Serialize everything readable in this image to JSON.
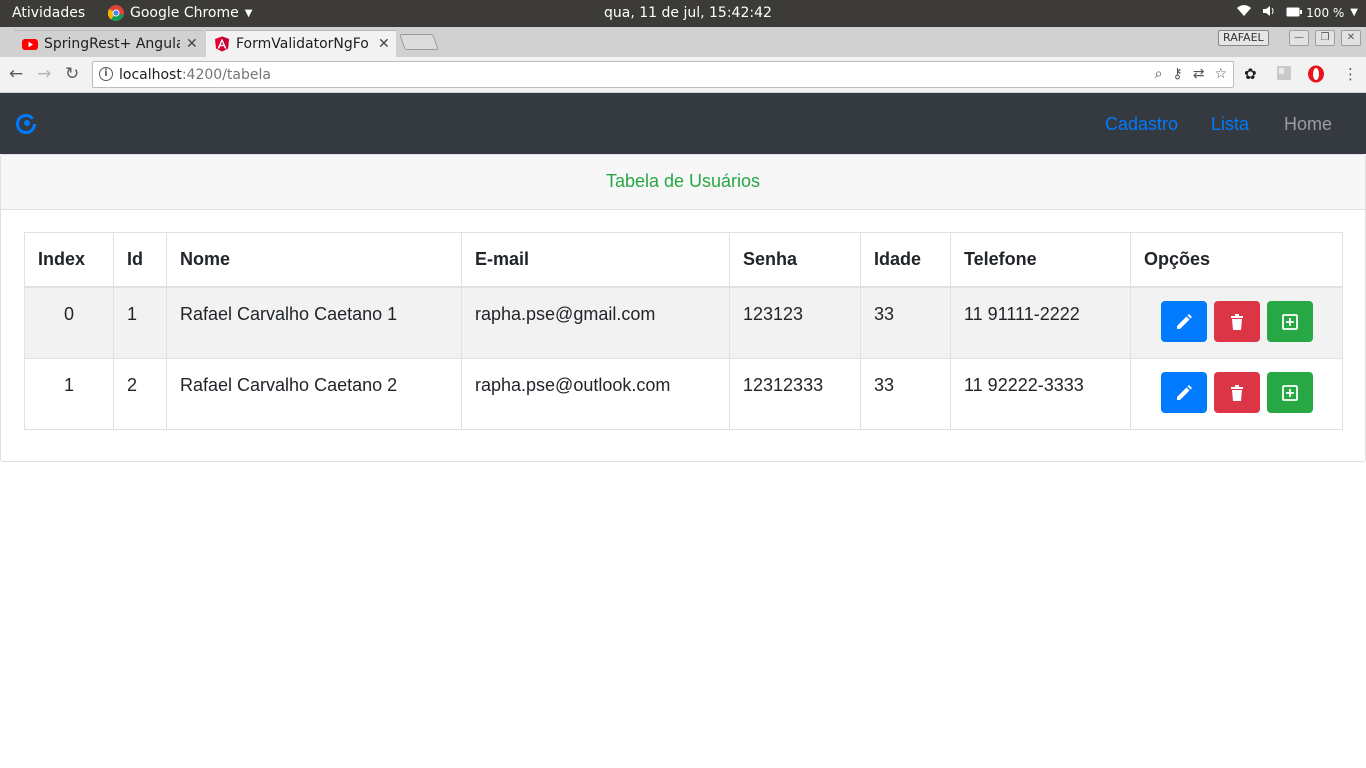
{
  "os_bar": {
    "activities": "Atividades",
    "app_name": "Google Chrome",
    "clock": "qua, 11 de jul, 15:42:42",
    "battery": "100 %"
  },
  "browser": {
    "tabs": [
      {
        "title": "SpringRest+ Angula",
        "active": false,
        "favicon": "youtube-icon"
      },
      {
        "title": "FormValidatorNgFo",
        "active": true,
        "favicon": "angular-icon"
      }
    ],
    "profile": "RAFAEL",
    "url_host": "localhost",
    "url_rest": ":4200/tabela"
  },
  "navbar": {
    "links": [
      "Cadastro",
      "Lista",
      "Home"
    ]
  },
  "card": {
    "header": "Tabela de Usuários"
  },
  "table": {
    "headers": [
      "Index",
      "Id",
      "Nome",
      "E-mail",
      "Senha",
      "Idade",
      "Telefone",
      "Opções"
    ],
    "rows": [
      {
        "index": "0",
        "id": "1",
        "nome": "Rafael Carvalho Caetano 1",
        "email": "rapha.pse@gmail.com",
        "senha": "123123",
        "idade": "33",
        "telefone": "11 91111-2222"
      },
      {
        "index": "1",
        "id": "2",
        "nome": "Rafael Carvalho Caetano 2",
        "email": "rapha.pse@outlook.com",
        "senha": "12312333",
        "idade": "33",
        "telefone": "11 92222-3333"
      }
    ]
  },
  "colors": {
    "primary": "#007bff",
    "danger": "#dc3545",
    "success": "#28a745",
    "navbar_bg": "#343a40"
  }
}
